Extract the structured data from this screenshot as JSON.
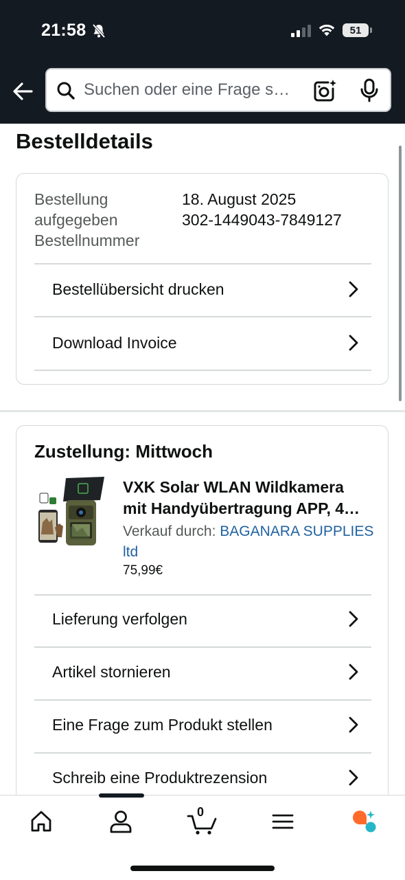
{
  "status_bar": {
    "time": "21:58",
    "battery": "51"
  },
  "search": {
    "placeholder": "Suchen oder eine Frage s…"
  },
  "page": {
    "title": "Bestelldetails"
  },
  "order_info": {
    "labels": [
      "Bestellung",
      "aufgegeben",
      "Bestellnummer"
    ],
    "date": "18. August 2025",
    "order_number": "302-1449043-7849127",
    "actions": [
      "Bestellübersicht drucken",
      "Download Invoice"
    ]
  },
  "delivery": {
    "title": "Zustellung: Mittwoch",
    "product": {
      "title_line1": "VXK Solar WLAN Wildkamera",
      "title_line2": "mit Handyübertragung APP, 4…",
      "seller_prefix": "Verkauf durch:",
      "seller_name_line1": "BAGANARA SUPPLIES",
      "seller_name_line2": "ltd",
      "price": "75,99€"
    },
    "actions": [
      "Lieferung verfolgen",
      "Artikel stornieren",
      "Eine Frage zum Produkt stellen",
      "Schreib eine Produktrezension"
    ]
  },
  "bottom_nav": {
    "cart_count": "0",
    "items": [
      "home-icon",
      "account-icon",
      "cart-icon",
      "menu-icon",
      "rufus-assistant-icon"
    ]
  },
  "colors": {
    "header_bg": "#131a22",
    "link": "#2162a1",
    "secondary_text": "#565959",
    "divider": "#d5d9d9"
  }
}
